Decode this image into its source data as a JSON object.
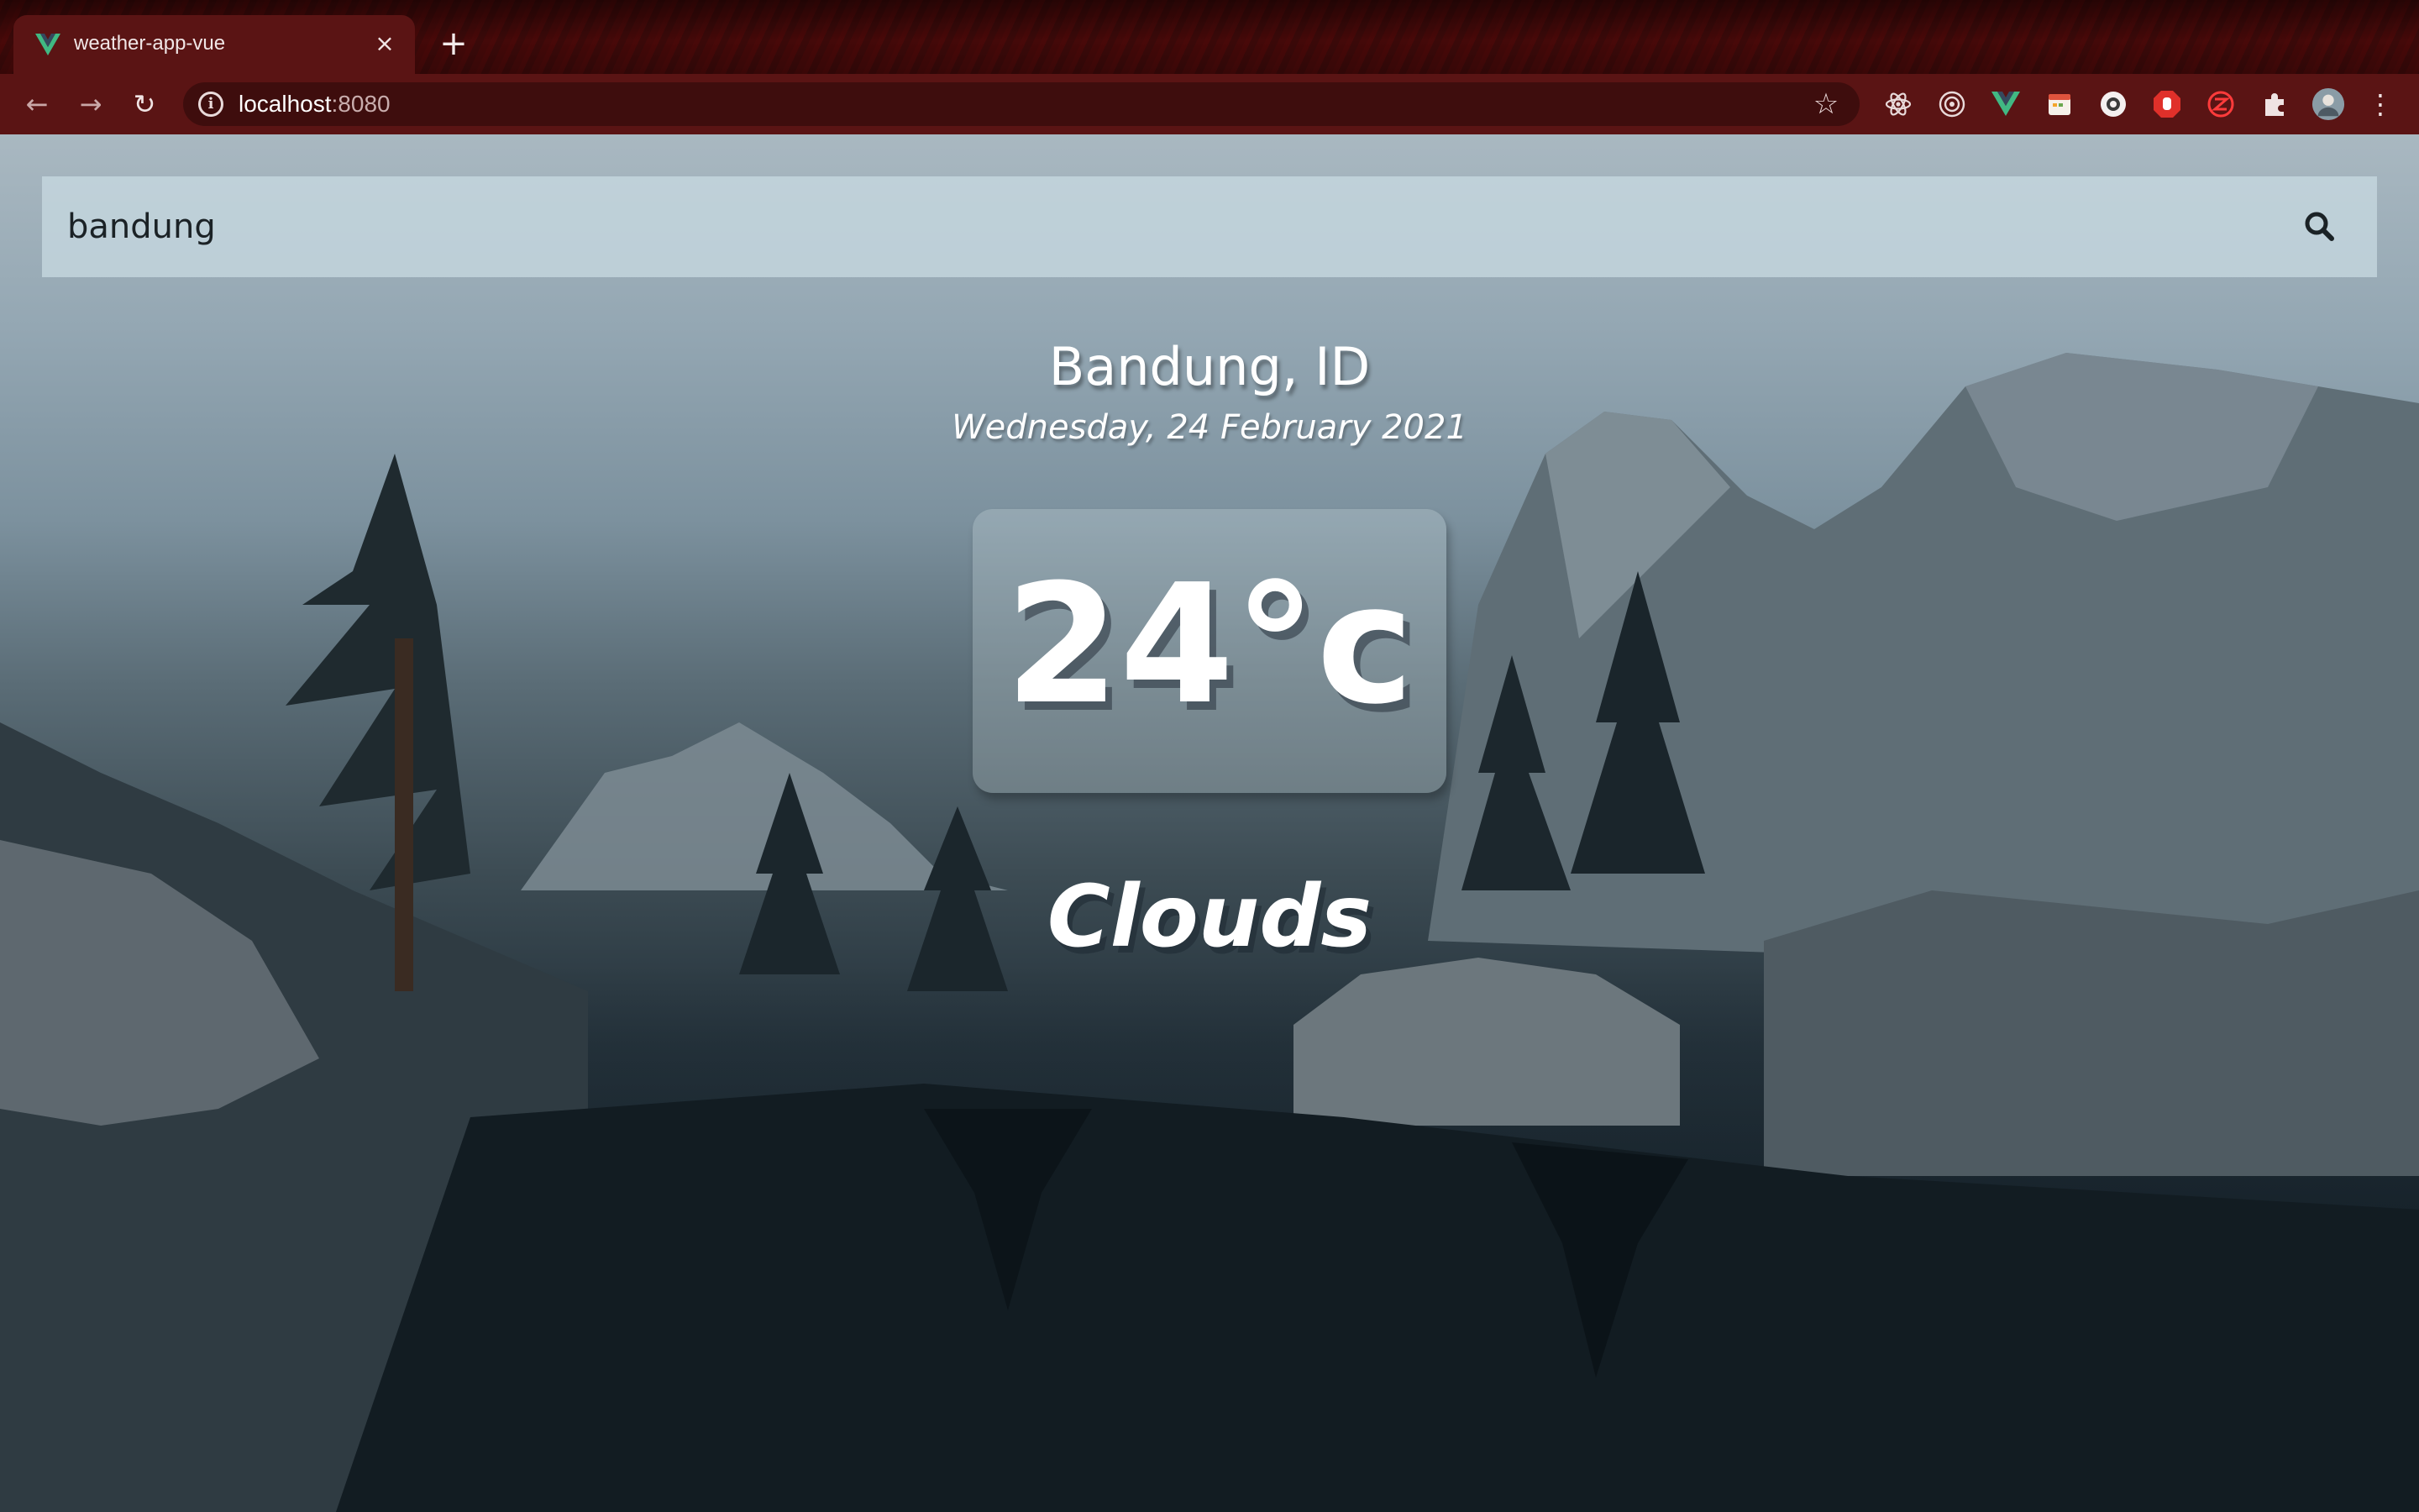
{
  "browser": {
    "tab_title": "weather-app-vue",
    "tab_close_label": "×",
    "new_tab_label": "+",
    "url_host": "localhost",
    "url_port": ":8080",
    "back_label": "←",
    "forward_label": "→",
    "reload_label": "↻",
    "bookmark_label": "☆",
    "menu_label": "⋮",
    "extensions": [
      "react-devtools-icon",
      "target-icon",
      "vue-devtools-icon",
      "calendar-icon",
      "circle-extension-icon",
      "adblock-hand-icon",
      "red-z-extension-icon",
      "puzzle-icon",
      "profile-avatar"
    ]
  },
  "search": {
    "value": "bandung",
    "icon": "search-icon"
  },
  "weather": {
    "location": "Bandung, ID",
    "date": "Wednesday, 24 February 2021",
    "temperature": "24°c",
    "condition": "Clouds"
  },
  "colors": {
    "chrome_dark": "#3b0909",
    "chrome_tab": "#5a1414",
    "search_bar": "#c6d8e0",
    "text": "#ffffff"
  }
}
